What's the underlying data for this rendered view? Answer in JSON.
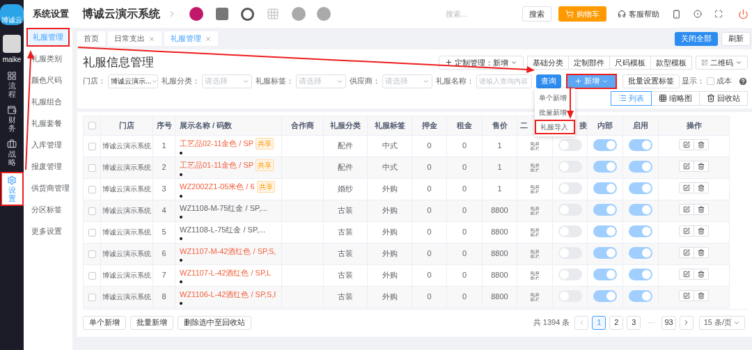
{
  "rail": {
    "logo_text": "博诚云",
    "user": "maike",
    "items": [
      {
        "label": "流程",
        "kind": "grid",
        "selected": false,
        "annotated": false
      },
      {
        "label": "财务",
        "kind": "wallet",
        "selected": false,
        "annotated": false
      },
      {
        "label": "战略",
        "kind": "briefcase",
        "selected": false,
        "annotated": false
      },
      {
        "label": "设置",
        "kind": "gear",
        "selected": true,
        "annotated": true
      }
    ]
  },
  "sidebar": {
    "title": "系统设置",
    "items": [
      {
        "label": "礼服管理",
        "selected": true,
        "annotated": true
      },
      {
        "label": "礼服类别",
        "selected": false,
        "annotated": false
      },
      {
        "label": "颜色尺码",
        "selected": false,
        "annotated": false
      },
      {
        "label": "礼服组合",
        "selected": false,
        "annotated": false
      },
      {
        "label": "礼服套餐",
        "selected": false,
        "annotated": false
      },
      {
        "label": "入库管理",
        "selected": false,
        "annotated": false
      },
      {
        "label": "报废管理",
        "selected": false,
        "annotated": false
      },
      {
        "label": "供货商管理",
        "selected": false,
        "annotated": false
      },
      {
        "label": "分区标签",
        "selected": false,
        "annotated": false
      },
      {
        "label": "更多设置",
        "selected": false,
        "annotated": false
      }
    ]
  },
  "header": {
    "title": "博诚云演示系统",
    "search": {
      "placeholder": "搜索..."
    },
    "search_button": "搜索",
    "cart_button": "购物车",
    "help": "客服帮助"
  },
  "tabs": [
    {
      "label": "首页",
      "closable": false,
      "selected": false
    },
    {
      "label": "日常支出",
      "closable": true,
      "selected": false
    },
    {
      "label": "礼服管理",
      "closable": true,
      "selected": true
    }
  ],
  "tab_actions": [
    {
      "label": "关闭全部",
      "kind": "primary"
    },
    {
      "label": "刷新",
      "kind": "plain"
    }
  ],
  "page": {
    "title": "礼服信息管理",
    "custom_button": "定制管理：新增",
    "template_buttons": [
      "基础分类",
      "定制部件",
      "尺码模板",
      "款型模板"
    ],
    "qr_button": "二维码",
    "filters": [
      {
        "label": "门店：",
        "value": "博诚云演示..."
      },
      {
        "label": "礼服分类：",
        "placeholder": "请选择"
      },
      {
        "label": "礼服标签：",
        "placeholder": "请选择"
      },
      {
        "label": "供应商：",
        "placeholder": "请选择"
      }
    ],
    "name_filter": {
      "label": "礼服名称：",
      "placeholder": "请输入查询内容"
    },
    "query_button": "查询",
    "add_button": {
      "label": "新增",
      "annotated": true
    },
    "tag_button": "批量设置标签",
    "show_label": "显示：",
    "cost": {
      "label": "成本",
      "checked": false
    },
    "views": [
      {
        "label": "列表",
        "kind": "list",
        "selected": true
      },
      {
        "label": "缩略图",
        "kind": "thumbs",
        "selected": false
      },
      {
        "label": "回收站",
        "kind": "trash",
        "selected": false
      }
    ]
  },
  "add_menu": [
    {
      "label": "单个新增",
      "annotated": false
    },
    {
      "label": "批量新增",
      "annotated": false
    },
    {
      "label": "礼服导入",
      "annotated": true
    }
  ],
  "table": {
    "select_all_checked": false,
    "columns": [
      "门店",
      "序号",
      "展示名称 / 码数",
      "合作商",
      "礼服分类",
      "礼服标签",
      "押金",
      "租金",
      "售价",
      "二",
      "接",
      "内部",
      "启用",
      "操作"
    ],
    "rows": [
      {
        "checked": false,
        "store": "博诚云演示系统",
        "no": "1",
        "name": "工艺品02-11金色 / SP",
        "color": "#f2603c",
        "badge": "共享",
        "category": "配件",
        "tag": "中式",
        "deposit": "0",
        "rent": "0",
        "price": "1",
        "external_on": false,
        "internal_on": true,
        "enabled_on": true
      },
      {
        "checked": false,
        "store": "博诚云演示系统",
        "no": "2",
        "name": "工艺品01-11金色 / SP",
        "color": "#f2603c",
        "badge": "共享",
        "category": "配件",
        "tag": "中式",
        "deposit": "0",
        "rent": "0",
        "price": "1",
        "external_on": false,
        "internal_on": true,
        "enabled_on": true
      },
      {
        "checked": false,
        "store": "博诚云演示系统",
        "no": "3",
        "name": "WZ2002Z1-05米色 / 6",
        "color": "#f2603c",
        "badge": "共享",
        "category": "婚纱",
        "tag": "外购",
        "deposit": "0",
        "rent": "0",
        "price": "1",
        "external_on": false,
        "internal_on": true,
        "enabled_on": true
      },
      {
        "checked": false,
        "store": "博诚云演示系统",
        "no": "4",
        "name": "WZ1108-M-75红金 / SP,...",
        "color": "#606266",
        "category": "古装",
        "tag": "外购",
        "deposit": "0",
        "rent": "0",
        "price": "8800",
        "external_on": false,
        "internal_on": true,
        "enabled_on": true
      },
      {
        "checked": false,
        "store": "博诚云演示系统",
        "no": "5",
        "name": "WZ1108-L-75红金 / SP,...",
        "color": "#606266",
        "category": "古装",
        "tag": "外购",
        "deposit": "0",
        "rent": "0",
        "price": "8800",
        "external_on": false,
        "internal_on": true,
        "enabled_on": true
      },
      {
        "checked": false,
        "store": "博诚云演示系统",
        "no": "6",
        "name": "WZ1107-M-42酒红色 / SP,S,",
        "color": "#f2603c",
        "category": "古装",
        "tag": "外购",
        "deposit": "0",
        "rent": "0",
        "price": "8800",
        "external_on": false,
        "internal_on": true,
        "enabled_on": true
      },
      {
        "checked": false,
        "store": "博诚云演示系统",
        "no": "7",
        "name": "WZ1107-L-42酒红色 / SP,L",
        "color": "#f2603c",
        "category": "古装",
        "tag": "外购",
        "deposit": "0",
        "rent": "0",
        "price": "8800",
        "external_on": false,
        "internal_on": true,
        "enabled_on": true
      },
      {
        "checked": false,
        "store": "博诚云演示系统",
        "no": "8",
        "name": "WZ1106-L-42酒红色 / SP,S,I",
        "color": "#f2603c",
        "category": "古装",
        "tag": "外购",
        "deposit": "0",
        "rent": "0",
        "price": "8800",
        "external_on": false,
        "internal_on": true,
        "enabled_on": true
      }
    ]
  },
  "footer": {
    "buttons": [
      "单个新增",
      "批量新增",
      "删除选中至回收站"
    ],
    "total": "共 1394 条",
    "pages": [
      {
        "label": "1",
        "kind": "page",
        "selected": true
      },
      {
        "label": "2",
        "kind": "page",
        "selected": false
      },
      {
        "label": "3",
        "kind": "page",
        "selected": false
      },
      {
        "label": "···",
        "kind": "ellipsis",
        "selected": false
      },
      {
        "label": "93",
        "kind": "page",
        "selected": false
      }
    ],
    "page_size": "15 条/页"
  }
}
